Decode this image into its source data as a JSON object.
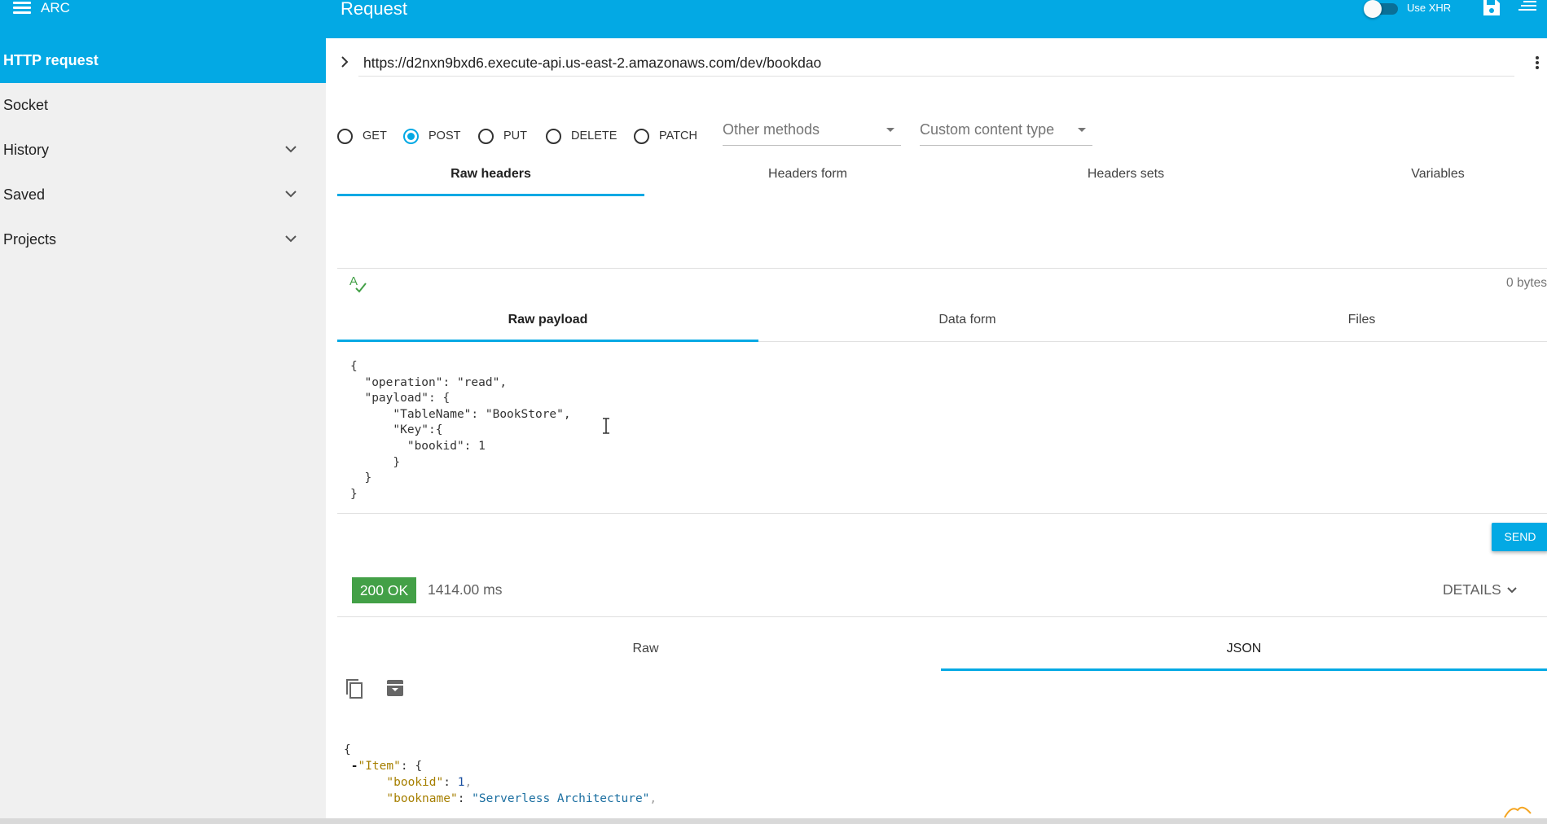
{
  "topbar": {
    "app_name": "ARC",
    "page_title": "Request",
    "xhr_label": "Use XHR",
    "xhr_enabled": false
  },
  "sidebar": {
    "items": [
      {
        "label": "HTTP request",
        "active": true,
        "expandable": false
      },
      {
        "label": "Socket",
        "active": false,
        "expandable": false
      },
      {
        "label": "History",
        "active": false,
        "expandable": true
      },
      {
        "label": "Saved",
        "active": false,
        "expandable": true
      },
      {
        "label": "Projects",
        "active": false,
        "expandable": true
      }
    ]
  },
  "request": {
    "url": "https://d2nxn9bxd6.execute-api.us-east-2.amazonaws.com/dev/bookdao",
    "methods": [
      {
        "label": "GET",
        "selected": false
      },
      {
        "label": "POST",
        "selected": true
      },
      {
        "label": "PUT",
        "selected": false
      },
      {
        "label": "DELETE",
        "selected": false
      },
      {
        "label": "PATCH",
        "selected": false
      }
    ],
    "other_methods": "Other methods",
    "content_type": "Custom content type",
    "header_tabs": [
      "Raw headers",
      "Headers form",
      "Headers sets",
      "Variables"
    ],
    "active_header_tab": "Raw headers",
    "headers_size": "0 bytes",
    "payload_tabs": [
      "Raw payload",
      "Data form",
      "Files"
    ],
    "active_payload_tab": "Raw payload",
    "payload_lines": [
      "{",
      "  \"operation\": \"read\",",
      "  \"payload\": {",
      "      \"TableName\": \"BookStore\",",
      "      \"Key\":{",
      "        \"bookid\": 1",
      "      }",
      "  }",
      "}"
    ],
    "send_label": "SEND"
  },
  "response": {
    "status": "200 OK",
    "status_color": "#43a047",
    "time": "1414.00 ms",
    "details_label": "DETAILS",
    "tabs": [
      "Raw",
      "JSON"
    ],
    "active_tab": "JSON",
    "json": {
      "item_key": "\"Item\"",
      "fields": [
        {
          "key": "\"bookid\"",
          "value": "1"
        },
        {
          "key": "\"bookname\"",
          "value": "\"Serverless Architecture\""
        }
      ]
    }
  },
  "colors": {
    "accent": "#03a9e4",
    "success": "#43a047"
  },
  "icons": [
    "menu-icon",
    "save-icon",
    "more-menu-icon",
    "chevron-right-icon",
    "more-vert-icon",
    "chevron-down-icon",
    "spellcheck-icon",
    "text-cursor-icon",
    "copy-icon",
    "archive-icon"
  ]
}
